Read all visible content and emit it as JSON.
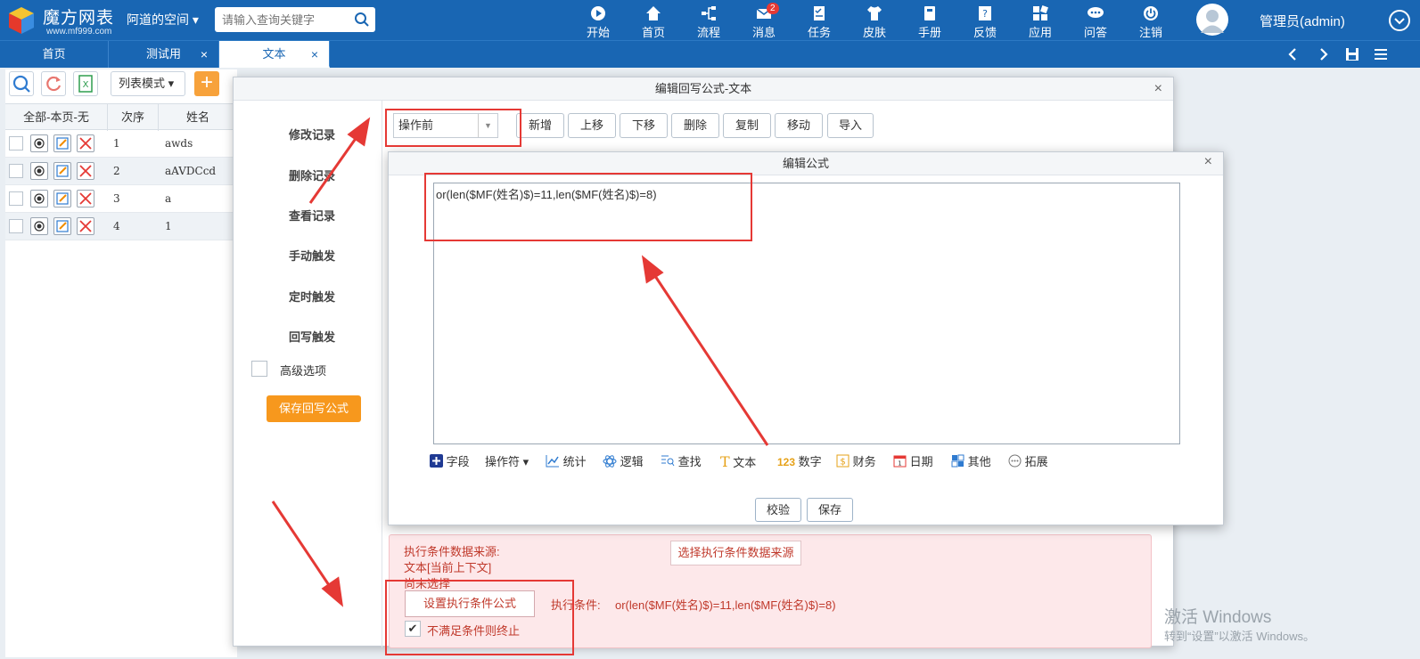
{
  "app": {
    "logo_title": "魔方网表",
    "logo_url": "www.mf999.com",
    "space": "阿道的空间 ▾",
    "search_placeholder": "请输入查询关键字"
  },
  "nav": [
    {
      "label": "开始",
      "icon": "play-icon"
    },
    {
      "label": "首页",
      "icon": "home-icon"
    },
    {
      "label": "流程",
      "icon": "flow-icon"
    },
    {
      "label": "消息",
      "icon": "mail-icon",
      "badge": "2"
    },
    {
      "label": "任务",
      "icon": "task-icon"
    },
    {
      "label": "皮肤",
      "icon": "shirt-icon"
    },
    {
      "label": "手册",
      "icon": "book-icon"
    },
    {
      "label": "反馈",
      "icon": "feedback-icon"
    },
    {
      "label": "应用",
      "icon": "apps-icon"
    },
    {
      "label": "问答",
      "icon": "qa-icon"
    },
    {
      "label": "注销",
      "icon": "power-icon"
    }
  ],
  "user": "管理员(admin)",
  "tabs": [
    {
      "label": "首页"
    },
    {
      "label": "测试用"
    },
    {
      "label": "文本"
    }
  ],
  "grid": {
    "list_mode": "列表模式",
    "headers": [
      "全部-本页-无",
      "次序",
      "姓名"
    ],
    "rows": [
      {
        "n": "1",
        "v": "awds"
      },
      {
        "n": "2",
        "v": "aAVDCcd"
      },
      {
        "n": "3",
        "v": "a"
      },
      {
        "n": "4",
        "v": "1"
      }
    ]
  },
  "dialog1": {
    "title": "编辑回写公式-文本",
    "menu": [
      "修改记录",
      "删除记录",
      "查看记录",
      "手动触发",
      "定时触发",
      "回写触发"
    ],
    "advanced": "高级选项",
    "save": "保存回写公式",
    "select": "操作前",
    "buttons": [
      "新增",
      "上移",
      "下移",
      "删除",
      "复制",
      "移动",
      "导入"
    ],
    "src_label": "执行条件数据来源:",
    "src_value": "文本[当前上下文]",
    "not_chosen": "尚未选择",
    "choose_btn": "选择执行条件数据来源",
    "set_btn": "设置执行条件公式",
    "cond_label": "执行条件:",
    "cond_value": "or(len($MF(姓名)$)=11,len($MF(姓名)$)=8)",
    "stop_label": "不满足条件则终止"
  },
  "dialog2": {
    "title": "编辑公式",
    "formula": "or(len($MF(姓名)$)=11,len($MF(姓名)$)=8)",
    "tools": [
      "字段",
      "操作符 ▾",
      "统计",
      "逻辑",
      "查找",
      "文本",
      "数字",
      "财务",
      "日期",
      "其他",
      "拓展"
    ],
    "validate": "校验",
    "save": "保存"
  },
  "watermark": {
    "line1": "激活 Windows",
    "line2": "转到“设置”以激活 Windows。"
  }
}
